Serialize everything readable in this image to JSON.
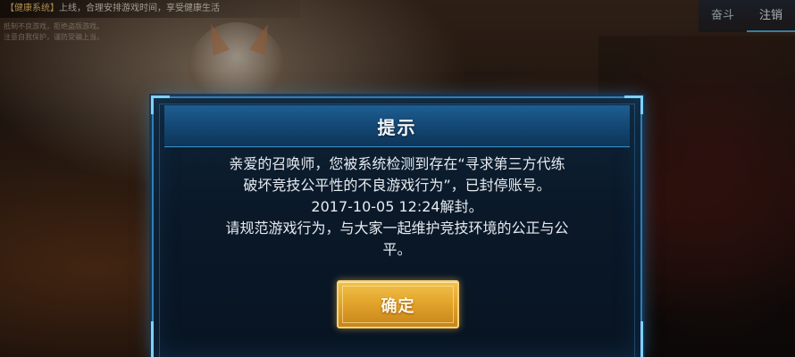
{
  "banner": {
    "tag": "【健康系统】",
    "text": "上线，合理安排游戏时间，享受健康生活"
  },
  "sub_notices": [
    "抵制不良游戏，拒绝盗版游戏。",
    "注意自我保护，谨防受骗上当。"
  ],
  "tabs": [
    {
      "label": "奋斗",
      "active": false
    },
    {
      "label": "注销",
      "active": true
    }
  ],
  "dialog": {
    "title": "提示",
    "lines": [
      "亲爱的召唤师，您被系统检测到存在“寻求第三方代练",
      "破坏竞技公平性的不良游戏行为”，已封停账号。",
      "2017-10-05 12:24解封。",
      "请规范游戏行为，与大家一起维护竞技环境的公正与公",
      "平。"
    ],
    "confirm_label": "确定"
  },
  "colors": {
    "dialog_border": "#2f7fb4",
    "dialog_bg": "#0a1828",
    "button_gold": "#e3a52c",
    "text": "#e6ebf0"
  }
}
